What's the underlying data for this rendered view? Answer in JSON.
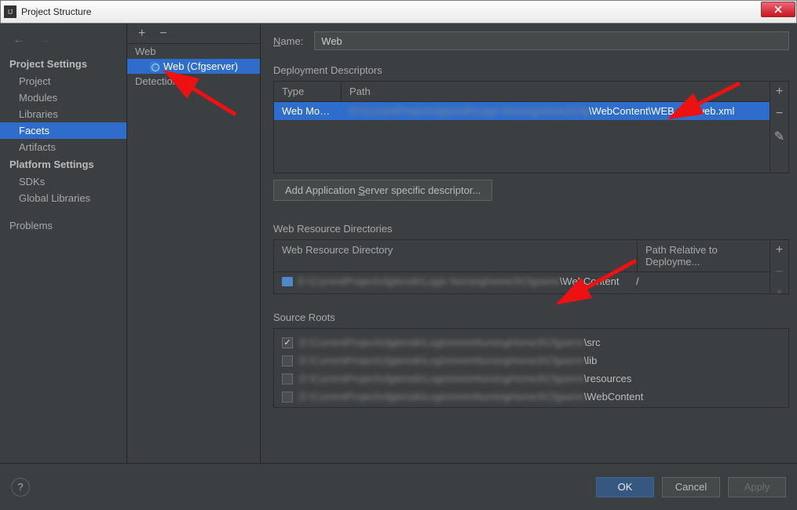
{
  "window": {
    "title": "Project Structure"
  },
  "sidebar": {
    "sections": {
      "project_settings": "Project Settings",
      "platform_settings": "Platform Settings"
    },
    "items": {
      "project": "Project",
      "modules": "Modules",
      "libraries": "Libraries",
      "facets": "Facets",
      "artifacts": "Artifacts",
      "sdks": "SDKs",
      "global_libraries": "Global Libraries",
      "problems": "Problems"
    }
  },
  "middle": {
    "root": "Web",
    "selected": "Web (Cfgserver)",
    "detection": "Detection"
  },
  "main": {
    "name_label": "Name:",
    "name_value": "Web",
    "deploy": {
      "title": "Deployment Descriptors",
      "col_type": "Type",
      "col_path": "Path",
      "row_type": "Web Modul...",
      "row_path_end": "\\WebContent\\WEB-INF\\web.xml",
      "button": "Add Application Server specific descriptor..."
    },
    "resources": {
      "title": "Web Resource Directories",
      "col_dir": "Web Resource Directory",
      "col_rel": "Path Relative to Deployme...",
      "row_dir_end": "\\WebContent",
      "row_rel": "/"
    },
    "roots": {
      "title": "Source Roots",
      "items": [
        {
          "checked": true,
          "suffix": "\\src"
        },
        {
          "checked": false,
          "suffix": "\\lib"
        },
        {
          "checked": false,
          "suffix": "\\resources"
        },
        {
          "checked": false,
          "suffix": "\\WebContent"
        }
      ]
    }
  },
  "footer": {
    "ok": "OK",
    "cancel": "Cancel",
    "apply": "Apply"
  }
}
